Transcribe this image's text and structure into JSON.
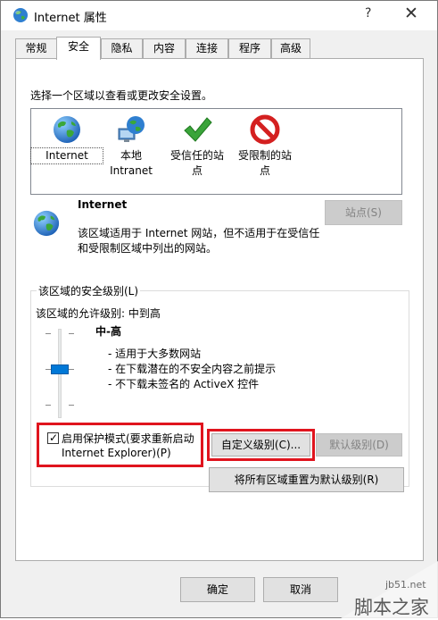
{
  "window": {
    "title": "Internet 属性",
    "help_glyph": "?",
    "close_glyph": "✕"
  },
  "tabs": [
    "常规",
    "安全",
    "隐私",
    "内容",
    "连接",
    "程序",
    "高级"
  ],
  "instruction": "选择一个区域以查看或更改安全设置。",
  "zones": [
    {
      "label": "Internet",
      "icon": "globe-icon",
      "selected": true
    },
    {
      "label": "本地\nIntranet",
      "icon": "intranet-icon"
    },
    {
      "label": "受信任的站\n点",
      "icon": "trusted-checkmark-icon"
    },
    {
      "label": "受限制的站\n点",
      "icon": "restricted-no-entry-icon"
    }
  ],
  "zone_info": {
    "title": "Internet",
    "description_line1": "该区域适用于 Internet 网站，但不适用于在受信任",
    "description_line2": "和受限制区域中列出的网站。",
    "sites_button": "站点(S)"
  },
  "security_level": {
    "group_title": "该区域的安全级别(L)",
    "allowed_levels": "该区域的允许级别: 中到高",
    "level_name": "中-高",
    "bullets": [
      "- 适用于大多数网站",
      "- 在下载潜在的不安全内容之前提示",
      "- 不下载未签名的 ActiveX 控件"
    ],
    "level_fraction": 0.5
  },
  "protected_mode": {
    "line1": "启用保护模式(要求重新启动",
    "line2": "Internet Explorer)(P)",
    "checked": true,
    "check_glyph": "✓"
  },
  "buttons": {
    "custom_level": "自定义级别(C)...",
    "default_level": "默认级别(D)",
    "reset_all": "将所有区域重置为默认级别(R)",
    "ok": "确定",
    "cancel": "取消"
  },
  "watermark": {
    "url": "jb51.net",
    "text": "脚本之家"
  },
  "colors": {
    "highlight_red": "#e0141e",
    "slider_blue": "#0078d7"
  }
}
